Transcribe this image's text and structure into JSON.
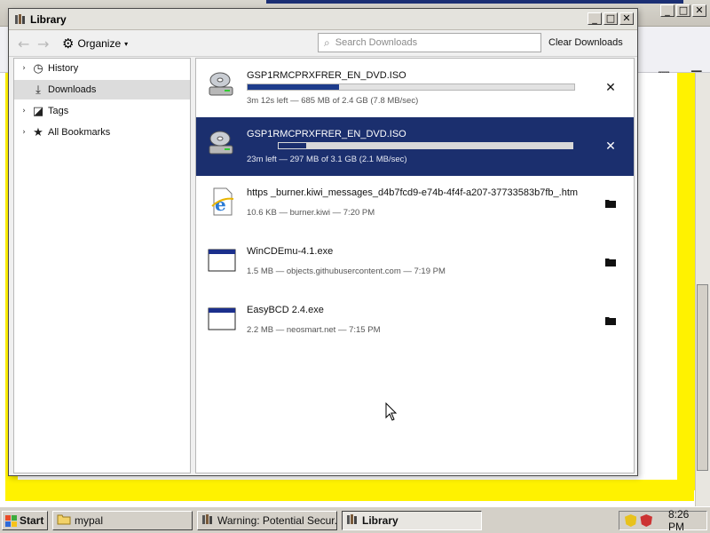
{
  "background_window": {
    "buttons": {
      "minimize": "_",
      "maximize": "□",
      "close": "✕"
    }
  },
  "library": {
    "title": "Library",
    "title_icon": "library-icon",
    "window_buttons": {
      "minimize": "_",
      "maximize": "□",
      "close": "✕"
    },
    "toolbar": {
      "back": "←",
      "forward": "→",
      "organize_label": "Organize",
      "search_placeholder": "Search Downloads",
      "clear_label": "Clear Downloads"
    },
    "sidebar": {
      "items": [
        {
          "label": "History",
          "icon": "clock-icon",
          "expandable": true
        },
        {
          "label": "Downloads",
          "icon": "download-icon",
          "expandable": false,
          "selected": true
        },
        {
          "label": "Tags",
          "icon": "tag-icon",
          "expandable": true
        },
        {
          "label": "All Bookmarks",
          "icon": "star-icon",
          "expandable": true
        }
      ]
    },
    "downloads": [
      {
        "name": "GSP1RMCPRXFRER_EN_DVD.ISO",
        "status": "3m 12s left — 685 MB of 2.4 GB (7.8 MB/sec)",
        "progress": 0.28,
        "action": "cancel",
        "icon": "disc-drive-icon",
        "selected": false
      },
      {
        "name": "GSP1RMCPRXFRER_EN_DVD.ISO",
        "status": "23m left — 297 MB of 3.1 GB (2.1 MB/sec)",
        "progress": 0.095,
        "action": "cancel",
        "icon": "disc-drive-icon",
        "selected": true
      },
      {
        "name": "https _burner.kiwi_messages_d4b7fcd9-e74b-4f4f-a207-37733583b7fb_.htm",
        "status": "10.6 KB — burner.kiwi — 7:20 PM",
        "action": "open-folder",
        "icon": "ie-page-icon",
        "selected": false
      },
      {
        "name": "WinCDEmu-4.1.exe",
        "status": "1.5 MB — objects.githubusercontent.com — 7:19 PM",
        "action": "open-folder",
        "icon": "exe-window-icon",
        "selected": false
      },
      {
        "name": "EasyBCD 2.4.exe",
        "status": "2.2 MB — neosmart.net — 7:15 PM",
        "action": "open-folder",
        "icon": "exe-window-icon",
        "selected": false
      }
    ]
  },
  "taskbar": {
    "start_label": "Start",
    "tasks": [
      {
        "label": "mypal",
        "icon": "folder-icon",
        "active": false
      },
      {
        "label": "Warning: Potential Secur...",
        "icon": "browser-icon",
        "active": false
      },
      {
        "label": "Library",
        "icon": "library-icon",
        "active": true
      }
    ],
    "clock": "8:26 PM"
  },
  "colors": {
    "selection": "#1b2f6e",
    "progress_fill": "#1d3c8c",
    "highlight_yellow": "#fff200"
  }
}
